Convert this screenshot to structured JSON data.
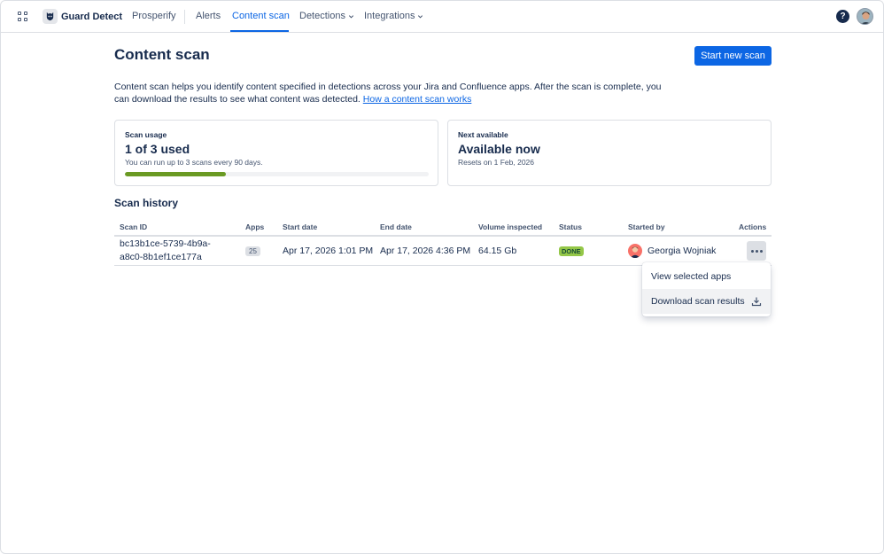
{
  "nav": {
    "brand": "Guard Detect",
    "site": "Prosperify",
    "items": [
      {
        "label": "Alerts"
      },
      {
        "label": "Content scan"
      },
      {
        "label": "Detections"
      },
      {
        "label": "Integrations"
      }
    ],
    "help": "?"
  },
  "page": {
    "title": "Content scan",
    "start_button": "Start new scan",
    "description": "Content scan helps you identify content specified in detections across your Jira and Confluence apps. After the scan is complete, you can download the results to see what content was detected. ",
    "link": "How a content scan works"
  },
  "usage_card": {
    "label": "Scan usage",
    "value": "1 of 3 used",
    "sub": "You can run up to 3 scans every 90 days.",
    "progress_fraction": 0.333
  },
  "availability_card": {
    "label": "Next available",
    "value": "Available now",
    "sub": "Resets on 1 Feb, 2026"
  },
  "history": {
    "title": "Scan history",
    "columns": [
      "Scan ID",
      "Apps",
      "Start date",
      "End date",
      "Volume inspected",
      "Status",
      "Started by",
      "Actions"
    ],
    "rows": [
      {
        "scan_id_line1": "bc13b1ce-5739-4b9a-",
        "scan_id_line2": "a8c0-8b1ef1ce177a",
        "apps": "25",
        "start": "Apr 17, 2026 1:01 PM",
        "end": "Apr 17, 2026 4:36 PM",
        "volume": "64.15 Gb",
        "status": "DONE",
        "started_by": "Georgia Wojniak"
      }
    ]
  },
  "menu": {
    "items": [
      {
        "label": "View selected apps"
      },
      {
        "label": "Download scan results"
      }
    ]
  },
  "colors": {
    "accent": "#0c66e4",
    "progress": "#6a9a23",
    "status_done": "#94c748"
  }
}
